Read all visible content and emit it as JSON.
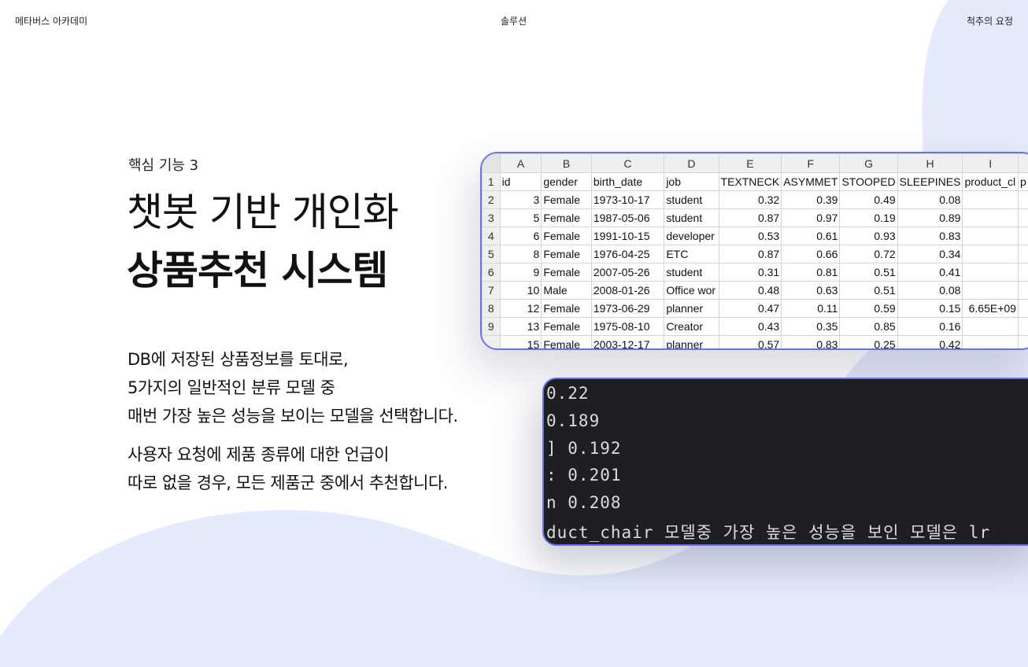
{
  "nav": {
    "left": "메타버스 아카데미",
    "center": "솔루션",
    "right": "척추의 요정"
  },
  "hero": {
    "feature_label": "핵심 기능 3",
    "title_line1": "챗봇 기반 개인화",
    "title_line2": "상품추천 시스템",
    "desc1_line1": "DB에 저장된 상품정보를 토대로,",
    "desc1_line2": "5가지의 일반적인 분류 모델 중",
    "desc1_line3": "매번 가장 높은 성능을 보이는 모델을 선택합니다.",
    "desc2_line1": "사용자 요청에 제품 종류에 대한 언급이",
    "desc2_line2": "따로 없을 경우, 모든 제품군 중에서 추천합니다."
  },
  "spreadsheet": {
    "col_letters": [
      "A",
      "B",
      "C",
      "D",
      "E",
      "F",
      "G",
      "H",
      "I",
      ""
    ],
    "header_row_num": "1",
    "headers": [
      "id",
      "gender",
      "birth_date",
      "job",
      "TEXTNECK",
      "ASYMMET",
      "STOOPED",
      "SLEEPINES",
      "product_cl",
      "p"
    ],
    "rows": [
      {
        "num": "2",
        "cells": [
          "3",
          "Female",
          "1973-10-17",
          "student",
          "0.32",
          "0.39",
          "0.49",
          "0.08",
          "",
          ""
        ]
      },
      {
        "num": "3",
        "cells": [
          "5",
          "Female",
          "1987-05-06",
          "student",
          "0.87",
          "0.97",
          "0.19",
          "0.89",
          "",
          ""
        ]
      },
      {
        "num": "4",
        "cells": [
          "6",
          "Female",
          "1991-10-15",
          "developer",
          "0.53",
          "0.61",
          "0.93",
          "0.83",
          "",
          ""
        ]
      },
      {
        "num": "5",
        "cells": [
          "8",
          "Female",
          "1976-04-25",
          "ETC",
          "0.87",
          "0.66",
          "0.72",
          "0.34",
          "",
          ""
        ]
      },
      {
        "num": "6",
        "cells": [
          "9",
          "Female",
          "2007-05-26",
          "student",
          "0.31",
          "0.81",
          "0.51",
          "0.41",
          "",
          ""
        ]
      },
      {
        "num": "7",
        "cells": [
          "10",
          "Male",
          "2008-01-26",
          "Office wor",
          "0.48",
          "0.63",
          "0.51",
          "0.08",
          "",
          ""
        ]
      },
      {
        "num": "8",
        "cells": [
          "12",
          "Female",
          "1973-06-29",
          "planner",
          "0.47",
          "0.11",
          "0.59",
          "0.15",
          "6.65E+09",
          ""
        ]
      },
      {
        "num": "9",
        "cells": [
          "13",
          "Female",
          "1975-08-10",
          "Creator",
          "0.43",
          "0.35",
          "0.85",
          "0.16",
          "",
          ""
        ]
      },
      {
        "num": "",
        "cells": [
          "15",
          "Female",
          "2003-12-17",
          "planner",
          "0.57",
          "0.83",
          "0.25",
          "0.42",
          "",
          ""
        ]
      }
    ]
  },
  "terminal": {
    "lines": [
      "0.22",
      "0.189",
      "] 0.192",
      ": 0.201",
      "n 0.208",
      "duct_chair 모델중 가장 높은 성능을 보인 모델은 lr"
    ]
  },
  "colors": {
    "accent_border": "#6b72e6",
    "blob": "#e5eafc",
    "terminal_bg": "#1e1f22"
  }
}
